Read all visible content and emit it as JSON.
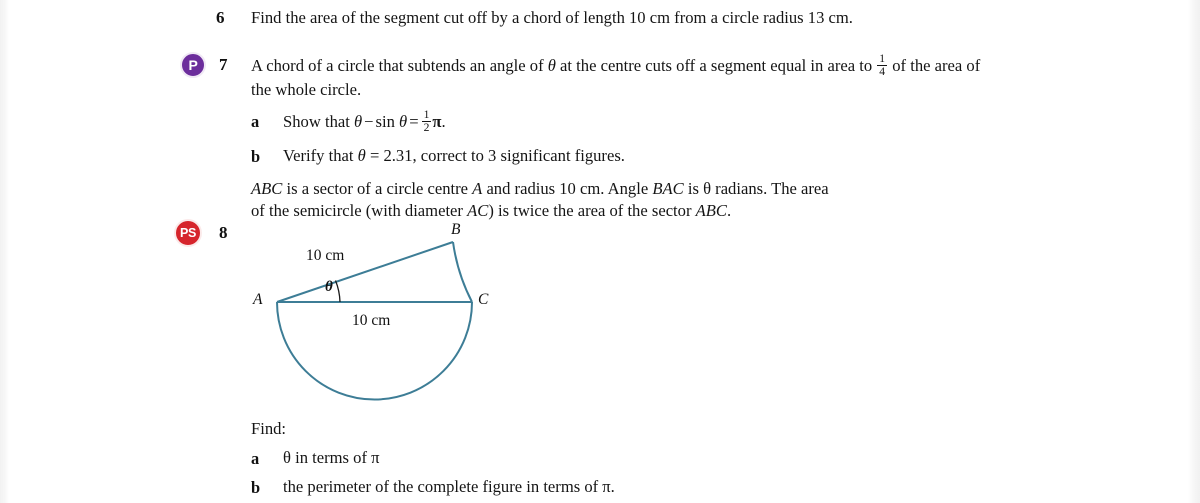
{
  "colors": {
    "badge_p": "#6c2d9c",
    "badge_ps": "#d6252c",
    "figure_stroke": "#3d7d96",
    "text": "#151515",
    "page_bg": "#ffffff"
  },
  "questions": [
    {
      "number": "6",
      "badge": null,
      "text": "Find the area of the segment cut off by a chord of length 10 cm from a circle radius 13 cm."
    },
    {
      "number": "7",
      "badge": "P",
      "text_part1": "A chord of a circle that subtends an angle of ",
      "theta": "θ",
      "text_part2": " at the centre cuts off a segment equal in area to ",
      "frac_num": "1",
      "frac_den": "4",
      "text_part3": " of the area of the whole circle.",
      "parts": [
        {
          "label": "a",
          "prefix": "Show that ",
          "eq_theta": "θ",
          "eq_minus": "−",
          "eq_sin": "sin",
          "eq_theta2": "θ",
          "eq_equals": "=",
          "eq_frac_num": "1",
          "eq_frac_den": "2",
          "eq_pi": "π",
          "suffix": "."
        },
        {
          "label": "b",
          "text_before": "Verify that ",
          "symbol": "θ",
          "text_after": " = 2.31, correct to 3 significant figures."
        }
      ]
    },
    {
      "number": "8",
      "badge": "PS",
      "stem_line1_a": "ABC",
      "stem_line1_b": " is a sector of a circle centre ",
      "stem_line1_c": "A",
      "stem_line1_d": " and radius 10 cm. Angle ",
      "stem_line1_e": "BAC",
      "stem_line1_f": " is θ radians. The area",
      "stem_line2_a": "of the semicircle (with diameter ",
      "stem_line2_b": "AC",
      "stem_line2_c": ") is twice the area of the sector ",
      "stem_line2_d": "ABC",
      "stem_line2_e": ".",
      "find_label": "Find:",
      "parts": [
        {
          "label": "a",
          "text": "θ in terms of π"
        },
        {
          "label": "b",
          "text": "the perimeter of the complete figure in terms of π."
        }
      ]
    }
  ],
  "figure": {
    "point_a": "A",
    "point_b": "B",
    "point_c": "C",
    "angle_label": "θ",
    "radius_label": "10 cm",
    "diameter_label": "10 cm",
    "stroke_color": "#3d7d96"
  }
}
